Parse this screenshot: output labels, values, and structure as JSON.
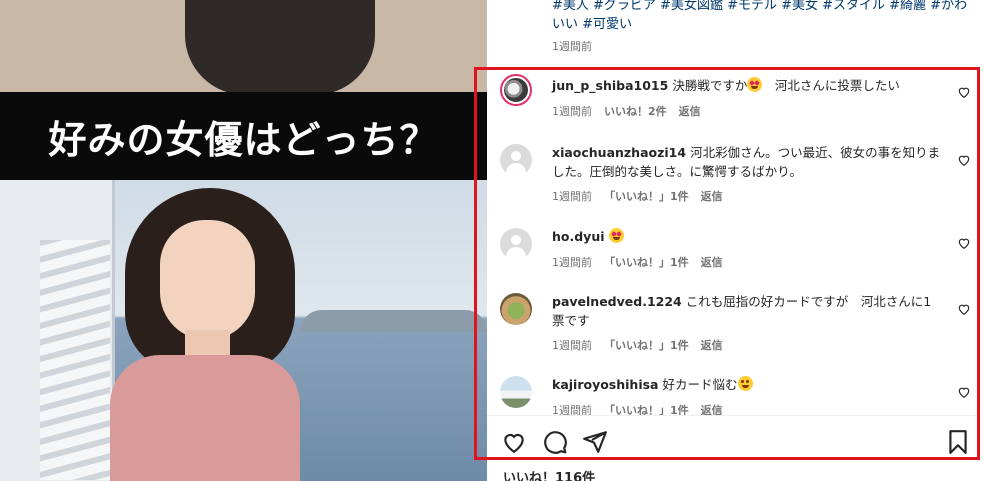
{
  "media": {
    "banner_text": "好みの女優はどっち？"
  },
  "caption": {
    "tags_line1": "#美人 #グラビア #美女図鑑 #モデル #美女 #スタイル #綺麗 #かわ",
    "tags_line2": "いい #可愛い",
    "time": "1週間前"
  },
  "comments": [
    {
      "username": "jun_p_shiba1015",
      "text_before_emoji": "決勝戦ですか",
      "emoji": "star-struck-emoji",
      "text_after_emoji": "　河北さんに投票したい",
      "time": "1週間前",
      "likes": "いいね！2件",
      "reply": "返信",
      "avatar": "profile-photo"
    },
    {
      "username": "xiaochuanzhaozi14",
      "text": "河北彩伽さん。つい最近、彼女の事を知りました。圧倒的な美しさ。に驚愕するばかり。",
      "time": "1週間前",
      "likes": "「いいね！」1件",
      "reply": "返信",
      "avatar": "default-avatar"
    },
    {
      "username": "ho.dyui",
      "emoji": "star-struck-emoji",
      "time": "1週間前",
      "likes": "「いいね！」1件",
      "reply": "返信",
      "avatar": "default-avatar"
    },
    {
      "username": "pavelnedved.1224",
      "text": "これも屈指の好カードですが　河北さんに1票です",
      "time": "1週間前",
      "likes": "「いいね！」1件",
      "reply": "返信",
      "avatar": "food-photo"
    },
    {
      "username": "kajiroyoshihisa",
      "text_before_emoji": "好カード悩む",
      "emoji": "grinning-sweat-emoji",
      "time": "1週間前",
      "likes": "「いいね！」1件",
      "reply": "返信",
      "avatar": "castle-photo"
    }
  ],
  "actions": {
    "like_icon": "heart-icon",
    "comment_icon": "comment-icon",
    "share_icon": "share-icon",
    "save_icon": "bookmark-icon"
  },
  "likes_count": "いいね！116件",
  "colors": {
    "highlight_border": "#e0141e",
    "hashtag": "#00376b",
    "meta_text": "#737373"
  }
}
